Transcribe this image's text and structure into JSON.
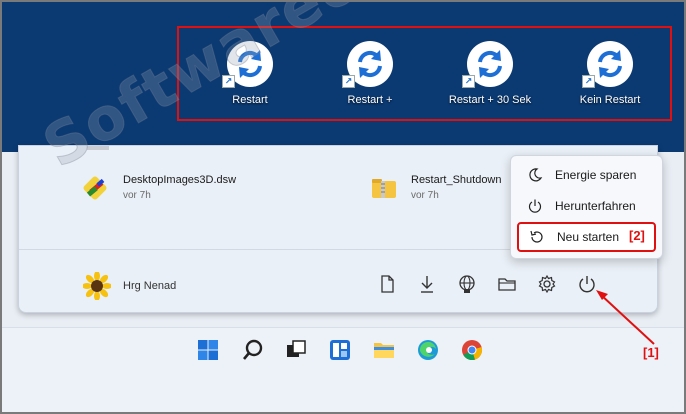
{
  "desktop": {
    "shortcuts": [
      {
        "label": "Restart"
      },
      {
        "label": "Restart +"
      },
      {
        "label": "Restart + 30 Sek"
      },
      {
        "label": "Kein Restart"
      }
    ]
  },
  "start_menu": {
    "files": [
      {
        "name": "DesktopImages3D.dsw",
        "time": "vor 7h"
      },
      {
        "name": "Restart_Shutdown",
        "time": "vor 7h"
      }
    ],
    "user": {
      "name": "Hrg Nenad"
    }
  },
  "power_menu": {
    "items": [
      {
        "label": "Energie sparen"
      },
      {
        "label": "Herunterfahren"
      },
      {
        "label": "Neu starten"
      }
    ]
  },
  "annotations": {
    "tag_power_menu": "[2]",
    "tag_power_button": "[1]"
  },
  "watermark": "Softwareok.de",
  "colors": {
    "desktop_bg": "#0b3a73",
    "accent_blue": "#1d6fd6",
    "highlight_red": "#e01010"
  }
}
